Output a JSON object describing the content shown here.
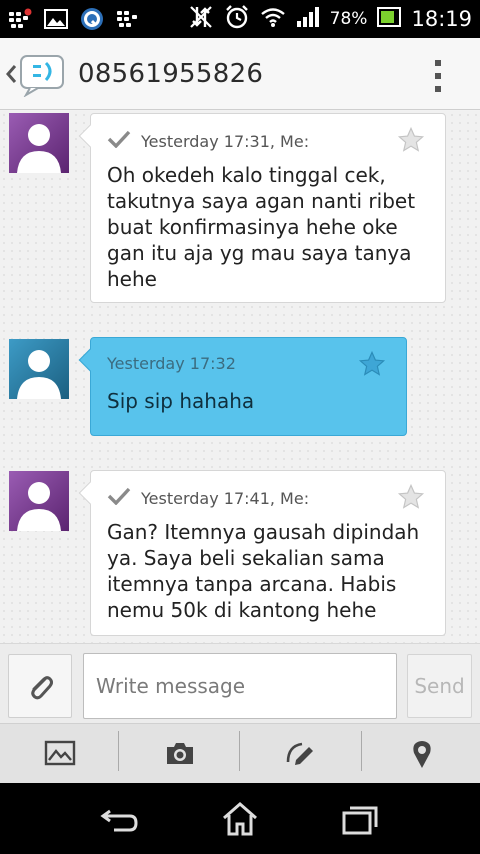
{
  "status_bar": {
    "icons": [
      "bbm-notification-icon",
      "gallery-notification-icon",
      "q-app-notification-icon",
      "bbm-icon",
      "data-off-icon",
      "alarm-icon",
      "wifi-icon",
      "signal-icon",
      "battery-icon"
    ],
    "battery_percent": "78%",
    "time": "18:19"
  },
  "header": {
    "title": "08561955826",
    "icons": [
      "back-icon",
      "messaging-app-icon",
      "overflow-menu-icon"
    ]
  },
  "messages": [
    {
      "direction": "sent",
      "meta": "Yesterday 17:31, Me:",
      "text": "Oh okedeh kalo tinggal cek, takutnya saya agan nanti ribet buat konfirmasinya hehe oke gan itu aja yg mau saya tanya hehe",
      "starred": false,
      "delivered": true
    },
    {
      "direction": "received",
      "meta": "Yesterday 17:32",
      "text": "Sip sip hahaha",
      "starred": false,
      "delivered": false
    },
    {
      "direction": "sent",
      "meta": "Yesterday 17:41, Me:",
      "text": "Gan? Itemnya gausah dipindah ya. Saya beli sekalian sama itemnya tanpa arcana. Habis nemu 50k di kantong hehe",
      "starred": false,
      "delivered": true
    }
  ],
  "compose": {
    "placeholder": "Write message",
    "value": "",
    "send_label": "Send"
  },
  "attachment_bar": {
    "icons": [
      "picture-icon",
      "camera-icon",
      "sketch-icon",
      "location-icon"
    ]
  },
  "nav_bar": {
    "icons": [
      "back-icon",
      "home-icon",
      "recent-apps-icon"
    ]
  },
  "colors": {
    "received_bubble": "#58c3ec",
    "sent_bubble": "#ffffff",
    "sent_avatar": "#7a3b91",
    "received_avatar": "#2a7ca3",
    "header_bg": "#f7f7f7",
    "status_bar": "#000000"
  }
}
